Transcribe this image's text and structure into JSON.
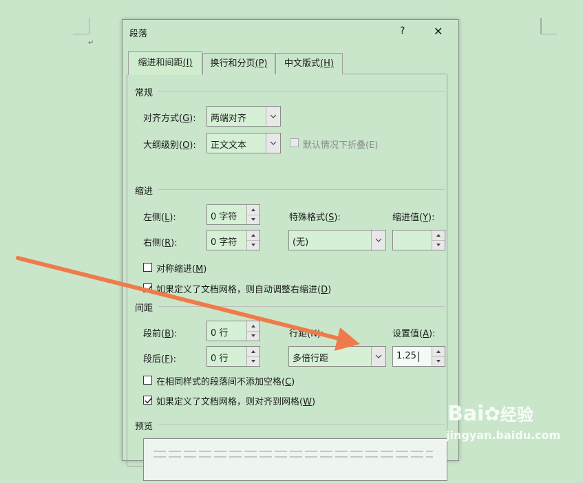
{
  "dialog": {
    "title": "段落",
    "help_label": "?",
    "close_label": "✕"
  },
  "tabs": [
    {
      "label": "缩进和间距",
      "hotkey": "(I)",
      "active": true
    },
    {
      "label": "换行和分页",
      "hotkey": "(P)",
      "active": false
    },
    {
      "label": "中文版式",
      "hotkey": "(H)",
      "active": false
    }
  ],
  "general": {
    "title": "常规",
    "alignment_label": "对齐方式(",
    "alignment_key": "G",
    "alignment_tail": "):",
    "alignment_value": "两端对齐",
    "outline_label": "大纲级别(",
    "outline_key": "O",
    "outline_tail": "):",
    "outline_value": "正文文本",
    "collapse_label": "默认情况下折叠(E)"
  },
  "indent": {
    "title": "缩进",
    "left_label": "左侧(",
    "left_key": "L",
    "left_tail": "):",
    "left_value": "0 字符",
    "right_label": "右侧(",
    "right_key": "R",
    "right_tail": "):",
    "right_value": "0 字符",
    "special_label": "特殊格式(",
    "special_key": "S",
    "special_tail": "):",
    "special_value": "(无)",
    "by_label": "缩进值(",
    "by_key": "Y",
    "by_tail": "):",
    "by_value": "",
    "mirror_label": "对称缩进(",
    "mirror_key": "M",
    "mirror_tail": ")",
    "mirror_checked": false,
    "grid_label": "如果定义了文档网格，则自动调整右缩进(",
    "grid_key": "D",
    "grid_tail": ")",
    "grid_checked": true
  },
  "spacing": {
    "title": "间距",
    "before_label": "段前(",
    "before_key": "B",
    "before_tail": "):",
    "before_value": "0 行",
    "after_label": "段后(",
    "after_key": "F",
    "after_tail": "):",
    "after_value": "0 行",
    "line_label": "行距(N):",
    "line_value": "多倍行距",
    "at_label": "设置值(",
    "at_key": "A",
    "at_tail": "):",
    "at_value": "1.25",
    "no_space_label": "在相同样式的段落间不添加空格(",
    "no_space_key": "C",
    "no_space_tail": ")",
    "no_space_checked": false,
    "snap_label": "如果定义了文档网格，则对齐到网格(",
    "snap_key": "W",
    "snap_tail": ")",
    "snap_checked": true
  },
  "preview": {
    "title": "预览"
  },
  "colors": {
    "background": "#c9e6cb",
    "arrow": "#f07b4a"
  },
  "watermark": {
    "brand": "Bai",
    "brand_tail": "经验",
    "url": "jingyan.baidu.com"
  }
}
